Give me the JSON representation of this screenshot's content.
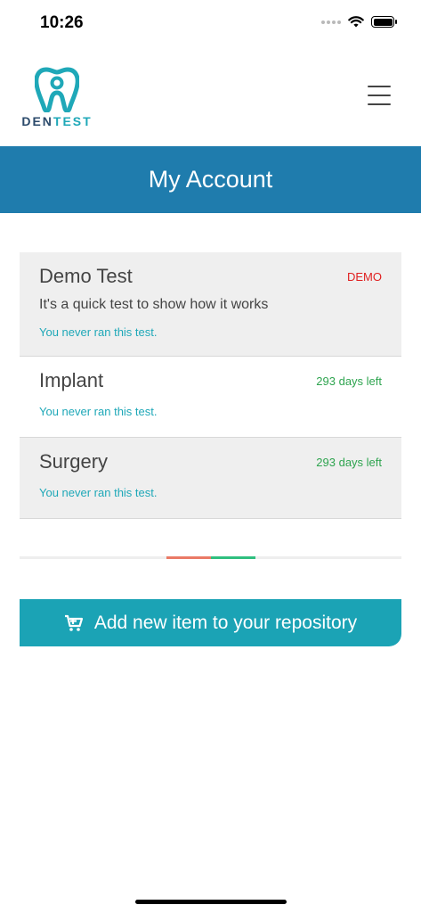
{
  "status_bar": {
    "time": "10:26"
  },
  "header": {
    "logo_den": "DEN",
    "logo_test": "TEST"
  },
  "page": {
    "title": "My Account"
  },
  "tests": [
    {
      "name": "Demo Test",
      "badge": "DEMO",
      "description": "It's a quick test to show how it works",
      "status": "You never ran this test."
    },
    {
      "name": "Implant",
      "badge": "293 days left",
      "status": "You never ran this test."
    },
    {
      "name": "Surgery",
      "badge": "293 days left",
      "status": "You never ran this test."
    }
  ],
  "add_button": {
    "label": "Add new item to your repository",
    "icon": "cart-plus-icon"
  },
  "colors": {
    "brand_blue": "#1f7cad",
    "accent_teal": "#1ba3b5",
    "demo_red": "#e02020",
    "days_green": "#2ea44f"
  }
}
